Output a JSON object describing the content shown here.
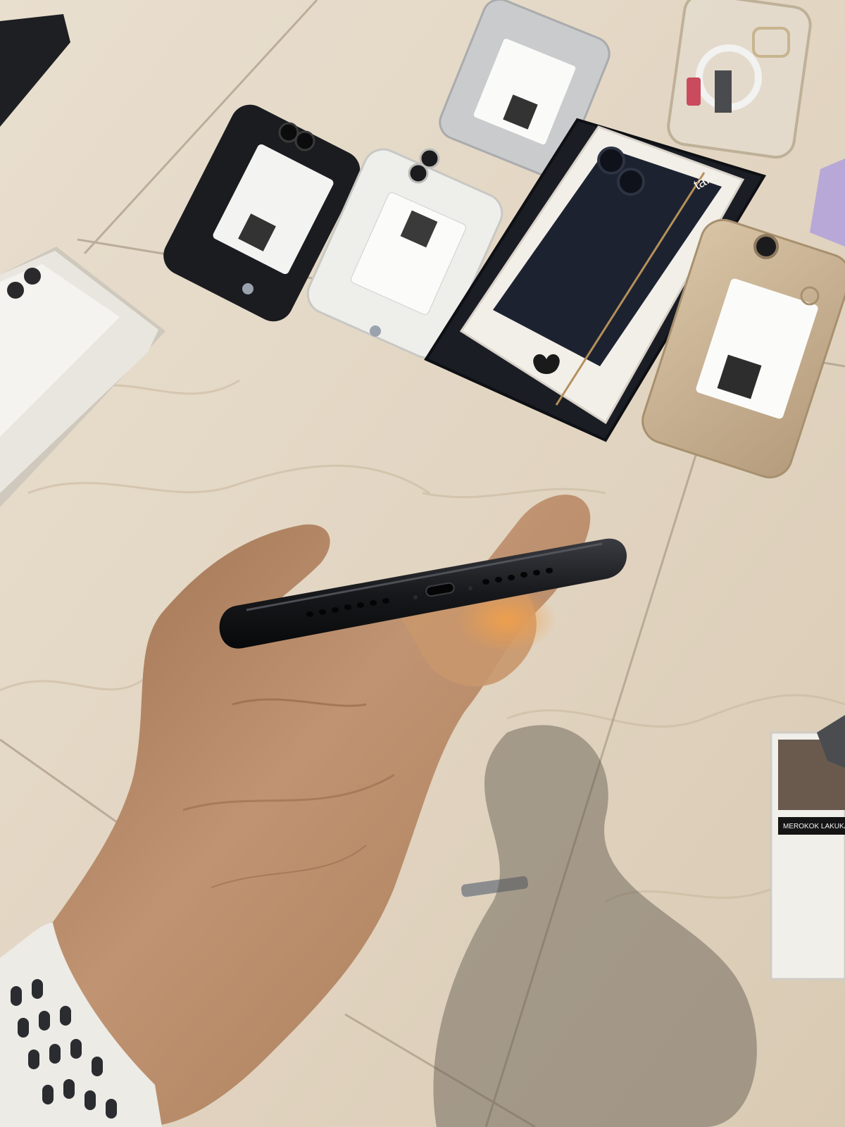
{
  "scene": {
    "subject": "hand holding black phone showing bottom edge",
    "colors": {
      "floor": "#e7dccb",
      "floor_vein": "#c9b79c",
      "grout": "#a99a86",
      "phone_black": "#1b1c1f",
      "phone_white": "#eeeeea",
      "phone_silver": "#c9cbcc",
      "phone_gold": "#cdb79a",
      "box_white": "#f2efe9",
      "box_dark": "#1a1d24",
      "skin": "#b88a63",
      "skin_shadow": "#8f6545",
      "watch_band": "#ecebe6"
    },
    "box_logo_text": "tam",
    "cigarette_pack_text": "MEROKOK\nLAKUKAN"
  }
}
